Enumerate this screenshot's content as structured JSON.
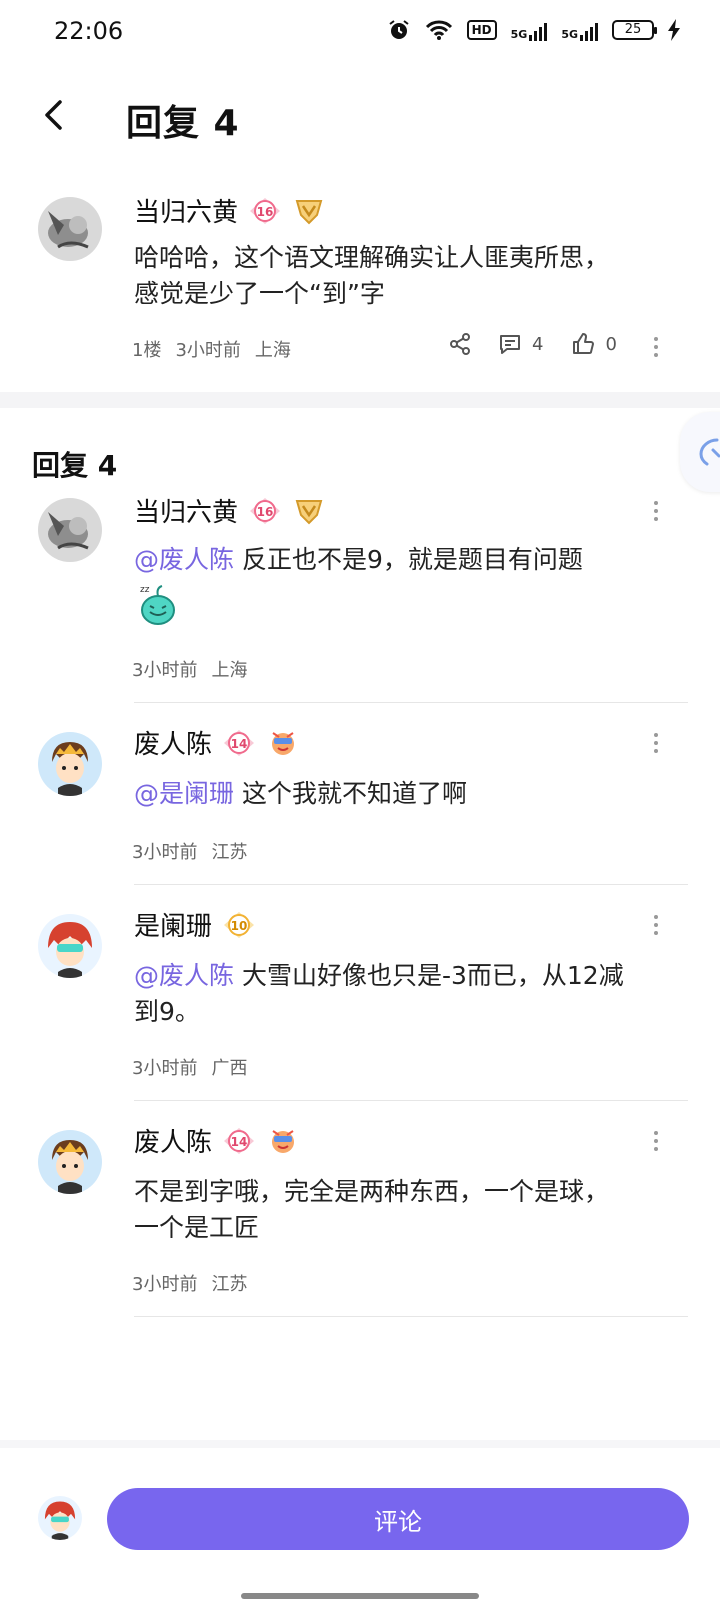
{
  "status": {
    "time": "22:06",
    "hd": "HD",
    "net1": "5G",
    "net2": "5G",
    "battery": "25"
  },
  "header": {
    "title": "回复 4"
  },
  "main_comment": {
    "user": "当归六黄",
    "level": "16",
    "text_line1": "哈哈哈，这个语文理解确实让人匪夷所思，",
    "text_line2": "感觉是少了一个“到”字",
    "floor": "1楼",
    "time": "3小时前",
    "location": "上海",
    "reply_count": "4",
    "like_count": "0"
  },
  "section": {
    "title": "回复 4"
  },
  "replies": [
    {
      "user": "当归六黄",
      "level": "16",
      "mention": "@废人陈",
      "text": " 反正也不是9，就是题目有问题",
      "time": "3小时前",
      "location": "上海"
    },
    {
      "user": "废人陈",
      "level": "14",
      "mention": "@是阑珊",
      "text": " 这个我就不知道了啊",
      "time": "3小时前",
      "location": "江苏"
    },
    {
      "user": "是阑珊",
      "level": "10",
      "mention": "@废人陈",
      "text": " 大雪山好像也只是-3而已，从12减",
      "text_line2": "到9。",
      "time": "3小时前",
      "location": "广西"
    },
    {
      "user": "废人陈",
      "level": "14",
      "text_line1": "不是到字哦，完全是两种东西，一个是球，",
      "text_line2": "一个是工匠",
      "time": "3小时前",
      "location": "江苏"
    }
  ],
  "bottom": {
    "comment_button": "评论"
  },
  "colors": {
    "accent": "#7866ee",
    "mention": "#7866e0",
    "level_badge": "#f06a8c",
    "level_badge_gold": "#f2b233"
  }
}
